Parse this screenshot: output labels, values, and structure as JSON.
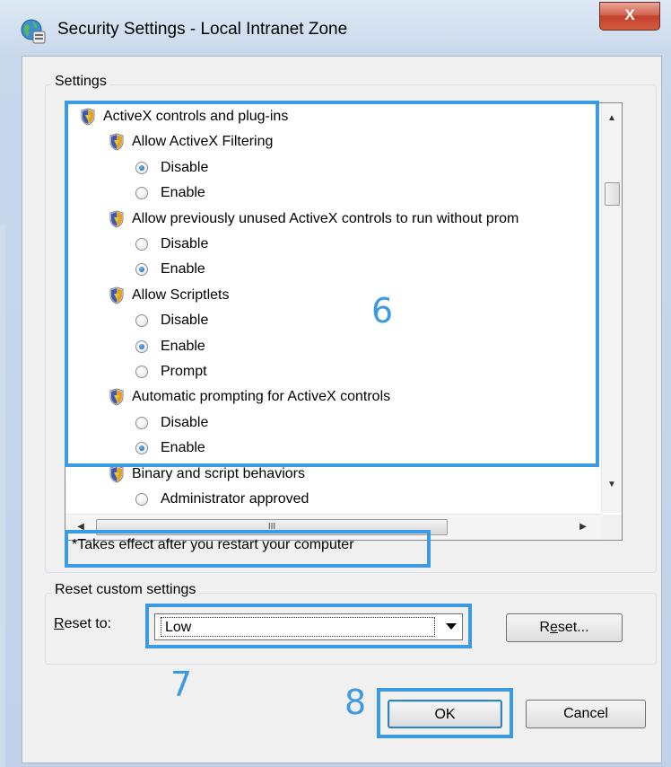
{
  "window": {
    "title": "Security Settings - Local Intranet Zone",
    "close_label": "X"
  },
  "settings_group": {
    "title": "Settings",
    "items": [
      {
        "type": "category",
        "label": "ActiveX controls and plug-ins"
      },
      {
        "type": "setting",
        "label": "Allow ActiveX Filtering"
      },
      {
        "type": "option",
        "label": "Disable",
        "checked": true
      },
      {
        "type": "option",
        "label": "Enable",
        "checked": false
      },
      {
        "type": "setting",
        "label": "Allow previously unused ActiveX controls to run without prom"
      },
      {
        "type": "option",
        "label": "Disable",
        "checked": false
      },
      {
        "type": "option",
        "label": "Enable",
        "checked": true
      },
      {
        "type": "setting",
        "label": "Allow Scriptlets"
      },
      {
        "type": "option",
        "label": "Disable",
        "checked": false
      },
      {
        "type": "option",
        "label": "Enable",
        "checked": true
      },
      {
        "type": "option",
        "label": "Prompt",
        "checked": false
      },
      {
        "type": "setting",
        "label": "Automatic prompting for ActiveX controls"
      },
      {
        "type": "option",
        "label": "Disable",
        "checked": false
      },
      {
        "type": "option",
        "label": "Enable",
        "checked": true
      },
      {
        "type": "setting",
        "label": "Binary and script behaviors"
      },
      {
        "type": "option",
        "label": "Administrator approved",
        "checked": false
      }
    ],
    "hscroll_grip": "III",
    "note": "*Takes effect after you restart your computer"
  },
  "reset_group": {
    "title": "Reset custom settings",
    "reset_to_label_first": "R",
    "reset_to_label_rest": "eset to:",
    "selected_value": "Low",
    "reset_button_pre": "R",
    "reset_button_ul": "e",
    "reset_button_post": "set..."
  },
  "buttons": {
    "ok": "OK",
    "cancel": "Cancel"
  },
  "annotations": {
    "six": "6",
    "seven": "7",
    "eight": "8"
  },
  "colors": {
    "annotation": "#3c9be0",
    "close_button": "#c2412b"
  }
}
